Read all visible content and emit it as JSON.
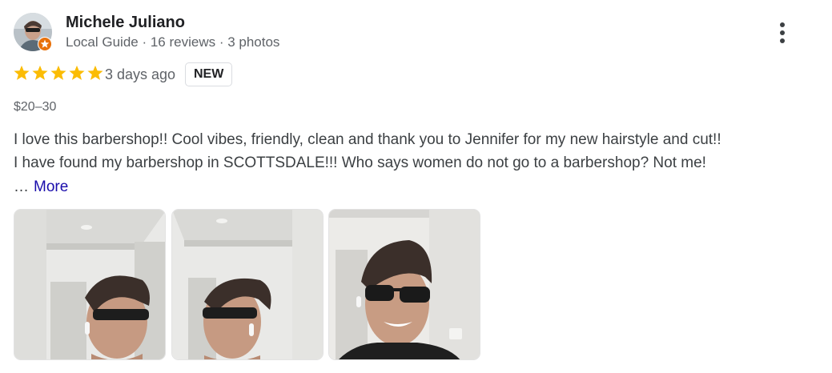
{
  "reviewer": {
    "name": "Michele Juliano",
    "meta": "Local Guide · 16 reviews · 3 photos",
    "avatar_icon": "avatar-photo",
    "badge_icon": "local-guide-star-badge",
    "badge_color": "#e8710a"
  },
  "rating": {
    "stars": 5,
    "star_color": "#fbbc04",
    "time": "3 days ago",
    "badge": "NEW"
  },
  "price": "$20–30",
  "review": {
    "line1": "I love this barbershop!! Cool vibes, friendly, clean and thank you to Jennifer for my new hairstyle and cut!!",
    "line2": "I have found my barbershop in SCOTTSDALE!!! Who says women do not go to a barbershop? Not me!",
    "ellipsis": "…",
    "more_label": "More"
  },
  "photos": [
    {
      "icon": "review-photo-1",
      "subject": "profile-facing-right-sunglasses"
    },
    {
      "icon": "review-photo-2",
      "subject": "profile-facing-left-sunglasses"
    },
    {
      "icon": "review-photo-3",
      "subject": "front-facing-sunglasses-smile"
    }
  ],
  "icons": {
    "more_options": "vertical-dots-icon",
    "star": "star-icon"
  }
}
